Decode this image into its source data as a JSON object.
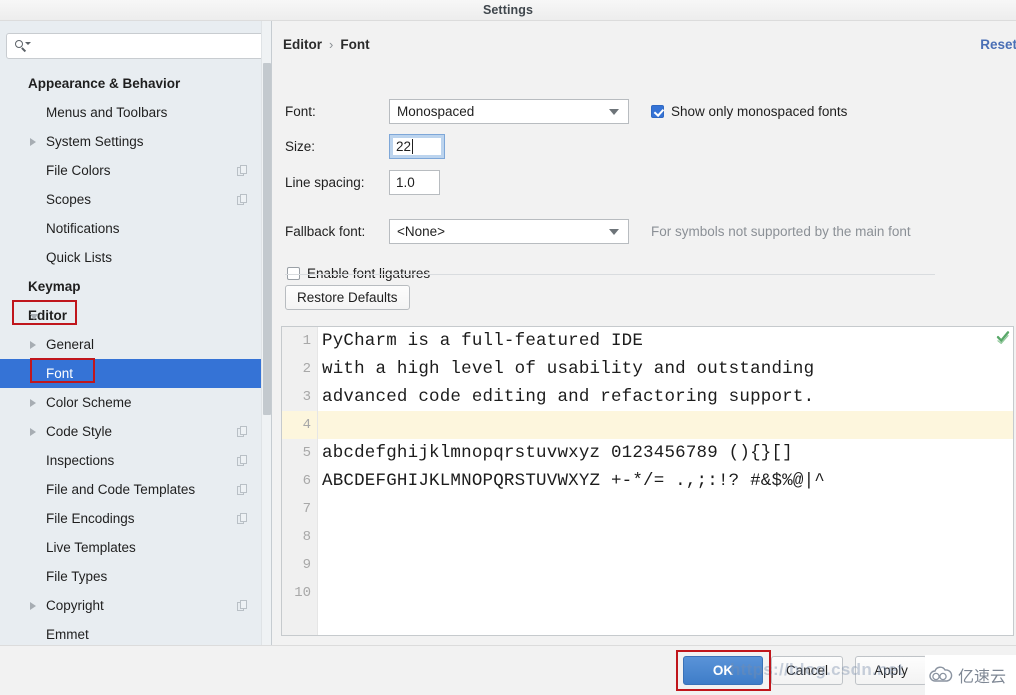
{
  "window": {
    "title": "Settings"
  },
  "search": {
    "placeholder": "",
    "value": "",
    "icon": "search-icon"
  },
  "sidebar": {
    "items": [
      {
        "label": "Appearance & Behavior",
        "level": 0,
        "twisty": "none",
        "copy": false,
        "selected": false
      },
      {
        "label": "Menus and Toolbars",
        "level": 1,
        "twisty": "none",
        "copy": false,
        "selected": false
      },
      {
        "label": "System Settings",
        "level": 1,
        "twisty": "right",
        "copy": false,
        "selected": false
      },
      {
        "label": "File Colors",
        "level": 1,
        "twisty": "none",
        "copy": true,
        "selected": false
      },
      {
        "label": "Scopes",
        "level": 1,
        "twisty": "none",
        "copy": true,
        "selected": false
      },
      {
        "label": "Notifications",
        "level": 1,
        "twisty": "none",
        "copy": false,
        "selected": false
      },
      {
        "label": "Quick Lists",
        "level": 1,
        "twisty": "none",
        "copy": false,
        "selected": false
      },
      {
        "label": "Keymap",
        "level": 0,
        "twisty": "none",
        "copy": false,
        "selected": false
      },
      {
        "label": "Editor",
        "level": 0,
        "twisty": "down",
        "copy": false,
        "selected": false
      },
      {
        "label": "General",
        "level": 1,
        "twisty": "right",
        "copy": false,
        "selected": false
      },
      {
        "label": "Font",
        "level": 1,
        "twisty": "none",
        "copy": false,
        "selected": true
      },
      {
        "label": "Color Scheme",
        "level": 1,
        "twisty": "right",
        "copy": false,
        "selected": false
      },
      {
        "label": "Code Style",
        "level": 1,
        "twisty": "right",
        "copy": true,
        "selected": false
      },
      {
        "label": "Inspections",
        "level": 1,
        "twisty": "none",
        "copy": true,
        "selected": false
      },
      {
        "label": "File and Code Templates",
        "level": 1,
        "twisty": "none",
        "copy": true,
        "selected": false
      },
      {
        "label": "File Encodings",
        "level": 1,
        "twisty": "none",
        "copy": true,
        "selected": false
      },
      {
        "label": "Live Templates",
        "level": 1,
        "twisty": "none",
        "copy": false,
        "selected": false
      },
      {
        "label": "File Types",
        "level": 1,
        "twisty": "none",
        "copy": false,
        "selected": false
      },
      {
        "label": "Copyright",
        "level": 1,
        "twisty": "right",
        "copy": true,
        "selected": false
      },
      {
        "label": "Emmet",
        "level": 1,
        "twisty": "none",
        "copy": false,
        "selected": false
      }
    ]
  },
  "main": {
    "breadcrumb": {
      "parent": "Editor",
      "separator": "›",
      "current": "Font"
    },
    "reset_label": "Reset",
    "font_row": {
      "label": "Font:",
      "value": "Monospaced"
    },
    "size_row": {
      "label": "Size:",
      "value": "22"
    },
    "spacing_row": {
      "label": "Line spacing:",
      "value": "1.0"
    },
    "fallback_row": {
      "label": "Fallback font:",
      "value": "<None>",
      "hint": "For symbols not supported by the main font"
    },
    "monospaced_checkbox": {
      "label": "Show only monospaced fonts",
      "checked": true
    },
    "ligatures_checkbox": {
      "label": "Enable font ligatures",
      "checked": false
    },
    "restore_defaults_label": "Restore Defaults"
  },
  "preview": {
    "line_numbers": [
      "1",
      "2",
      "3",
      "4",
      "5",
      "6",
      "7",
      "8",
      "9",
      "10"
    ],
    "lines": [
      {
        "text": "PyCharm is a full-featured IDE",
        "highlighted": false
      },
      {
        "text": "with a high level of usability and outstanding",
        "highlighted": false
      },
      {
        "text": "advanced code editing and refactoring support.",
        "highlighted": false
      },
      {
        "text": "",
        "highlighted": true
      },
      {
        "text": "abcdefghijklmnopqrstuvwxyz 0123456789 (){}[]",
        "highlighted": false
      },
      {
        "text": "ABCDEFGHIJKLMNOPQRSTUVWXYZ +-*/= .,;:!? #&$%@|^",
        "highlighted": false
      },
      {
        "text": "",
        "highlighted": false
      },
      {
        "text": "",
        "highlighted": false
      },
      {
        "text": "",
        "highlighted": false
      },
      {
        "text": "",
        "highlighted": false
      }
    ],
    "inspection_icon": "green-checkmark-icon"
  },
  "footer": {
    "ok_label": "OK",
    "cancel_label": "Cancel",
    "apply_label": "Apply"
  },
  "watermark": {
    "url_text": "https://blog.csdn.net",
    "logo_text": "亿速云"
  },
  "colors": {
    "selection_blue": "#3573d6",
    "annotation_red": "#c0161c",
    "highlight_yellow": "#fdf6dd",
    "link_blue": "#4a6fb5"
  }
}
